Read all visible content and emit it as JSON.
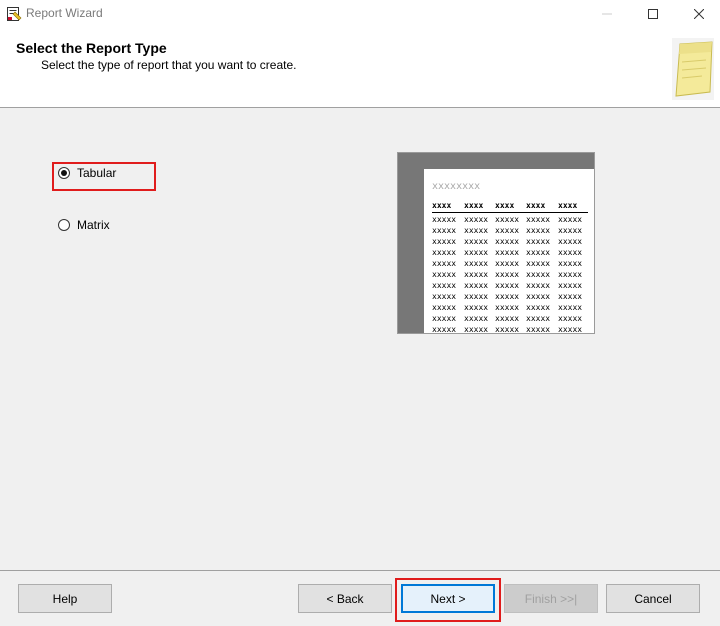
{
  "window": {
    "title": "Report Wizard",
    "icons": {
      "app": "report-wizard-icon",
      "minimize": "minimize-icon",
      "maximize": "maximize-icon",
      "close": "close-icon"
    }
  },
  "header": {
    "title": "Select the Report Type",
    "subtitle": "Select the type of report that you want to create.",
    "icon": "sticky-note-icon"
  },
  "options": {
    "tabular": {
      "label": "Tabular",
      "checked": true
    },
    "matrix": {
      "label": "Matrix",
      "checked": false
    }
  },
  "preview": {
    "title": "xxxxxxxx",
    "header_cells": [
      "xxxx",
      "xxxx",
      "xxxx",
      "xxxx",
      "xxxx"
    ],
    "cell_text": "xxxxx",
    "row_count": 11
  },
  "buttons": {
    "help": "Help",
    "back": "< Back",
    "next": "Next >",
    "finish": "Finish >>|",
    "cancel": "Cancel"
  },
  "colors": {
    "highlight": "#e01c1c",
    "focus": "#0078d7"
  }
}
